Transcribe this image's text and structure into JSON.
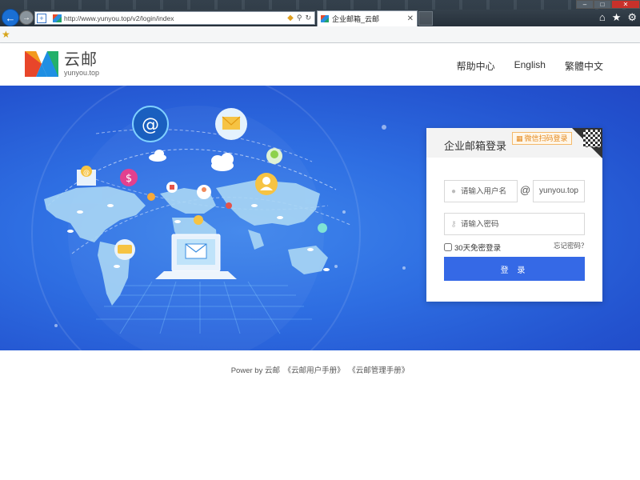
{
  "browser": {
    "url": "http://www.yunyou.top/v2/login/index",
    "tab_title": "企业邮箱_云邮",
    "back_glyph": "←",
    "forward_glyph": "→",
    "icons": [
      "back-icon",
      "forward-icon",
      "site-shield-icon",
      "compat-view-icon",
      "search-icon",
      "refresh-icon",
      "tab-close-icon",
      "home-icon",
      "favorites-star-icon",
      "gear-icon",
      "add-favorite-icon"
    ]
  },
  "header": {
    "logo_name": "云邮",
    "logo_domain": "yunyou.top",
    "nav": [
      "帮助中心",
      "English",
      "繁體中文"
    ]
  },
  "login": {
    "title": "企业邮箱登录",
    "wechat_label": "微信扫码登录",
    "username_placeholder": "请输入用户名",
    "at": "@",
    "domain": "yunyou.top",
    "password_placeholder": "请输入密码",
    "remember_label": "30天免密登录",
    "forgot_label": "忘记密码？",
    "submit_label": "登 录"
  },
  "footer": {
    "prefix": "Power by 云邮",
    "user_manual": "《云邮用户手册》",
    "admin_manual": "《云邮管理手册》"
  },
  "colors": {
    "hero_blue": "#2e6ee2",
    "button_blue": "#3569e6",
    "wechat_orange": "#e58a1f"
  }
}
